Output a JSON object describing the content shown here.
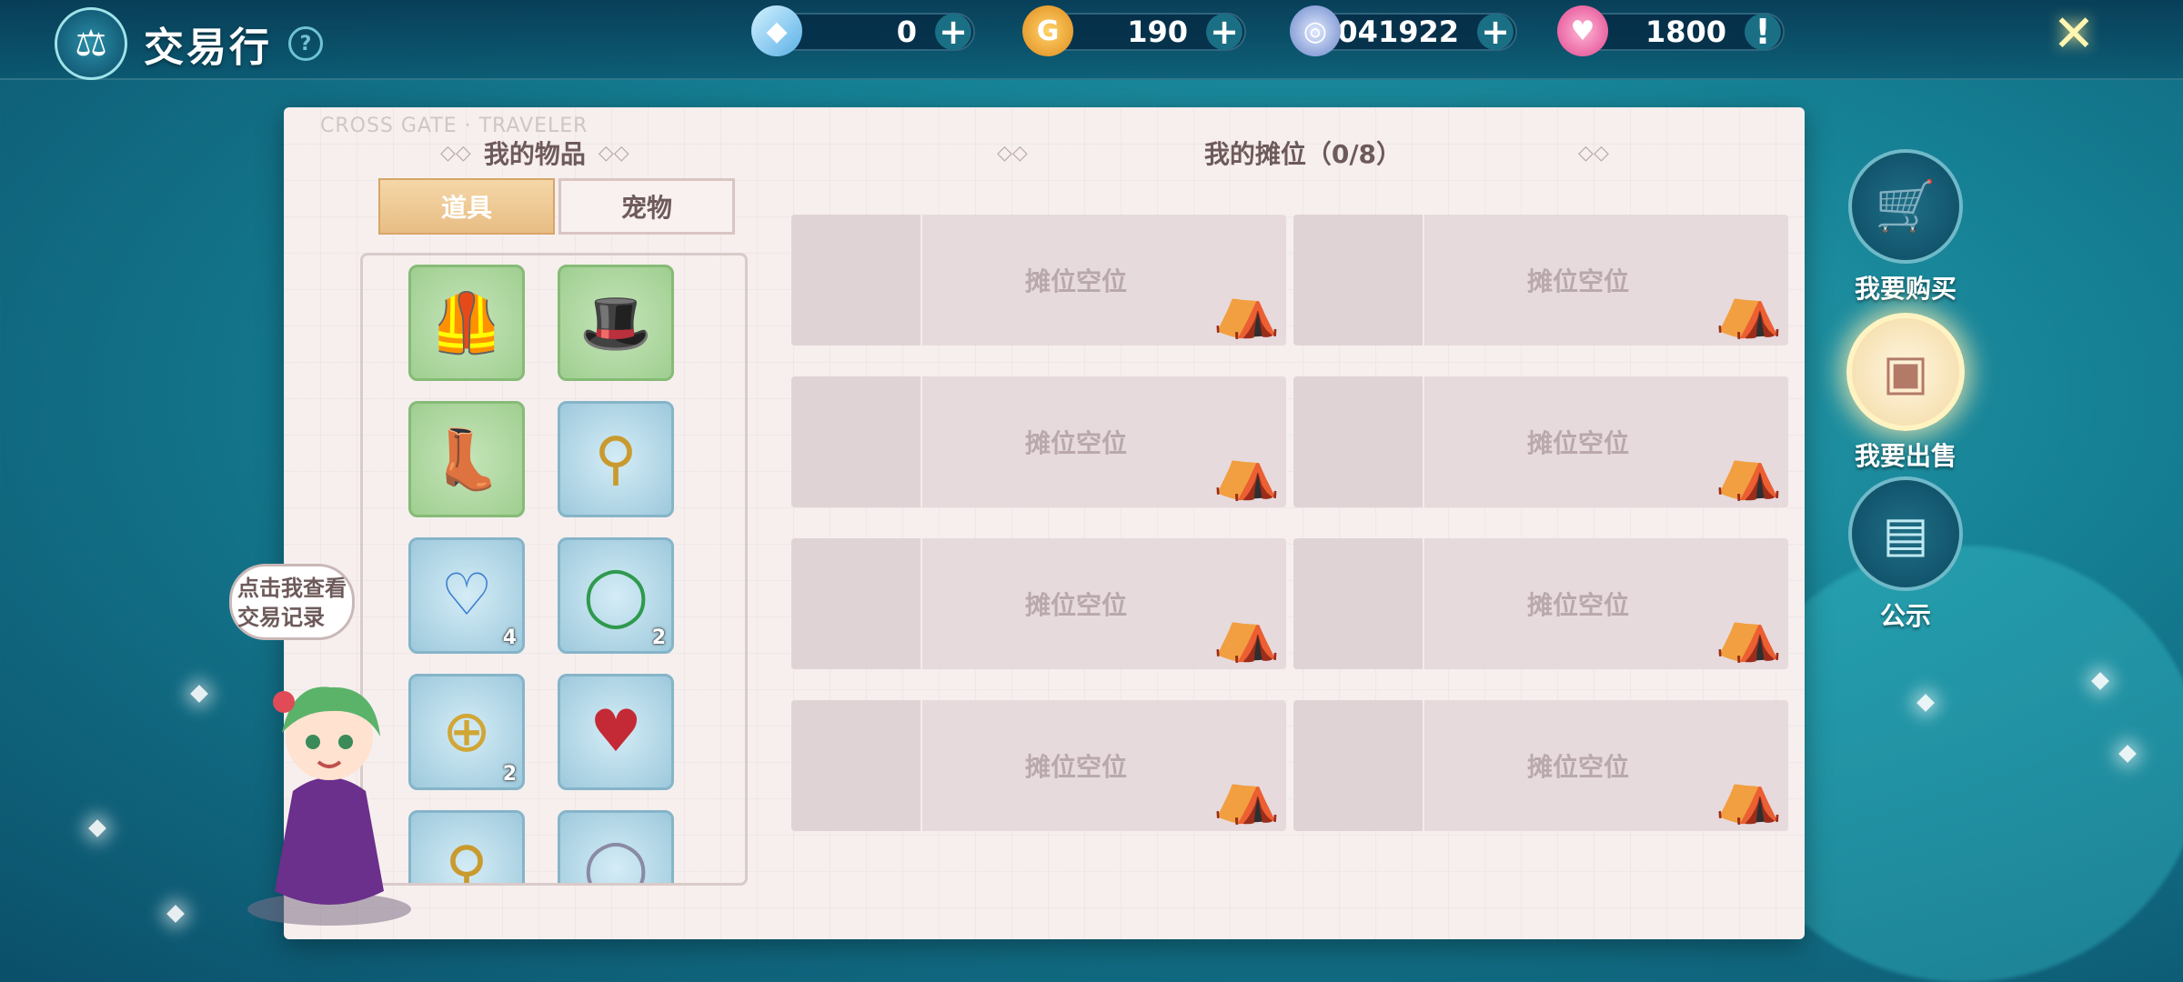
{
  "header": {
    "title": "交易行",
    "help_symbol": "?"
  },
  "currencies": [
    {
      "name": "crystal",
      "icon": "crystal-icon",
      "value": "0"
    },
    {
      "name": "gold",
      "icon": "gold-coin-icon",
      "value": "190"
    },
    {
      "name": "silver",
      "icon": "silver-coin-icon",
      "value": "3041922"
    },
    {
      "name": "heart",
      "icon": "heart-icon",
      "value": "1800"
    }
  ],
  "panel": {
    "stamp_text": "CROSS GATE · TRAVELER",
    "my_items_title": "我的物品",
    "my_stalls_title": "我的摊位（0/8）",
    "tabs": [
      {
        "label": "道具",
        "active": true
      },
      {
        "label": "宠物",
        "active": false
      }
    ],
    "items": [
      {
        "name": "armor-vest",
        "bg": "green",
        "count": ""
      },
      {
        "name": "top-hat",
        "bg": "green",
        "count": ""
      },
      {
        "name": "boots",
        "bg": "green",
        "count": ""
      },
      {
        "name": "earrings-gold",
        "bg": "blue",
        "count": ""
      },
      {
        "name": "fang-necklace",
        "bg": "blue",
        "count": "4"
      },
      {
        "name": "jade-bangle",
        "bg": "blue",
        "count": "2"
      },
      {
        "name": "coin-earrings",
        "bg": "blue",
        "count": "2"
      },
      {
        "name": "ruby-necklace",
        "bg": "blue",
        "count": ""
      },
      {
        "name": "partial-item-1",
        "bg": "blue",
        "count": ""
      },
      {
        "name": "partial-item-2",
        "bg": "blue",
        "count": ""
      }
    ],
    "stall_empty_label": "摊位空位",
    "stalls": [
      {
        "label": "摊位空位"
      },
      {
        "label": "摊位空位"
      },
      {
        "label": "摊位空位"
      },
      {
        "label": "摊位空位"
      },
      {
        "label": "摊位空位"
      },
      {
        "label": "摊位空位"
      },
      {
        "label": "摊位空位"
      },
      {
        "label": "摊位空位"
      }
    ]
  },
  "side_nav": [
    {
      "label": "我要购买",
      "icon": "cart-icon",
      "active": false
    },
    {
      "label": "我要出售",
      "icon": "sell-box-icon",
      "active": true
    },
    {
      "label": "公示",
      "icon": "bulletin-board-icon",
      "active": false
    }
  ],
  "mascot": {
    "bubble_text": "点击我查看交易记录"
  },
  "colors": {
    "accent_tab": "#e7bd84",
    "panel_bg": "#f6efee",
    "stall_bg": "#e6dadd",
    "title_text": "#6e5a5a"
  }
}
